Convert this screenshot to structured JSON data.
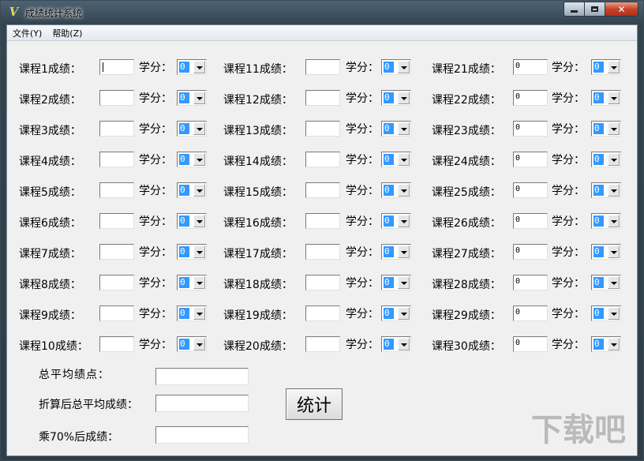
{
  "window": {
    "title": "成绩统计系统"
  },
  "menu": {
    "items": [
      "文件(Y)",
      "帮助(Z)"
    ]
  },
  "form": {
    "credit_label": "学分：",
    "columns": [
      {
        "rows": [
          {
            "label": "课程1成绩：",
            "score": "",
            "credit": "0"
          },
          {
            "label": "课程2成绩：",
            "score": "",
            "credit": "0"
          },
          {
            "label": "课程3成绩：",
            "score": "",
            "credit": "0"
          },
          {
            "label": "课程4成绩：",
            "score": "",
            "credit": "0"
          },
          {
            "label": "课程5成绩：",
            "score": "",
            "credit": "0"
          },
          {
            "label": "课程6成绩：",
            "score": "",
            "credit": "0"
          },
          {
            "label": "课程7成绩：",
            "score": "",
            "credit": "0"
          },
          {
            "label": "课程8成绩：",
            "score": "",
            "credit": "0"
          },
          {
            "label": "课程9成绩：",
            "score": "",
            "credit": "0"
          },
          {
            "label": "课程10成绩：",
            "score": "",
            "credit": "0"
          }
        ]
      },
      {
        "rows": [
          {
            "label": "课程11成绩：",
            "score": "",
            "credit": "0"
          },
          {
            "label": "课程12成绩：",
            "score": "",
            "credit": "0"
          },
          {
            "label": "课程13成绩：",
            "score": "",
            "credit": "0"
          },
          {
            "label": "课程14成绩：",
            "score": "",
            "credit": "0"
          },
          {
            "label": "课程15成绩：",
            "score": "",
            "credit": "0"
          },
          {
            "label": "课程16成绩：",
            "score": "",
            "credit": "0"
          },
          {
            "label": "课程17成绩：",
            "score": "",
            "credit": "0"
          },
          {
            "label": "课程18成绩：",
            "score": "",
            "credit": "0"
          },
          {
            "label": "课程19成绩：",
            "score": "",
            "credit": "0"
          },
          {
            "label": "课程20成绩：",
            "score": "",
            "credit": "0"
          }
        ]
      },
      {
        "rows": [
          {
            "label": "课程21成绩：",
            "score": "0",
            "credit": "0"
          },
          {
            "label": "课程22成绩：",
            "score": "0",
            "credit": "0"
          },
          {
            "label": "课程23成绩：",
            "score": "0",
            "credit": "0"
          },
          {
            "label": "课程24成绩：",
            "score": "0",
            "credit": "0"
          },
          {
            "label": "课程25成绩：",
            "score": "0",
            "credit": "0"
          },
          {
            "label": "课程26成绩：",
            "score": "0",
            "credit": "0"
          },
          {
            "label": "课程27成绩：",
            "score": "0",
            "credit": "0"
          },
          {
            "label": "课程28成绩：",
            "score": "0",
            "credit": "0"
          },
          {
            "label": "课程29成绩：",
            "score": "0",
            "credit": "0"
          },
          {
            "label": "课程30成绩：",
            "score": "0",
            "credit": "0"
          }
        ]
      }
    ]
  },
  "summary": {
    "gpa_label": "总平均绩点：",
    "weighted_avg_label": "折算后总平均成绩：",
    "times70_label": "乘70%后成绩：",
    "gpa_value": "",
    "weighted_avg_value": "",
    "times70_value": ""
  },
  "actions": {
    "stat_button": "统计"
  },
  "watermark": {
    "text": "下载吧"
  }
}
